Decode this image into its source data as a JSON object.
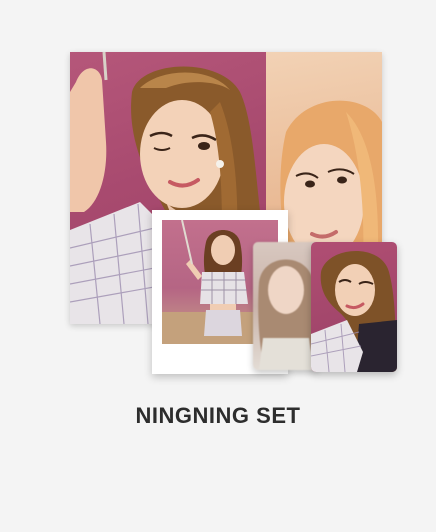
{
  "product": {
    "title": "NINGNING SET"
  },
  "colors": {
    "background": "#f4f4f4",
    "poster_pink": "#a84a6f",
    "poster_peach": "#e9b994",
    "title_text": "#2d2d2d"
  }
}
